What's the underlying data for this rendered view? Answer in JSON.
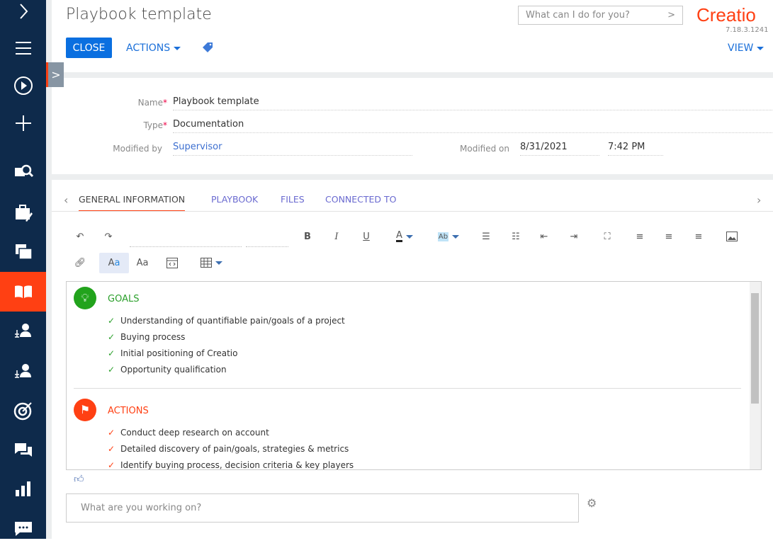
{
  "page": {
    "title": "Playbook template"
  },
  "toolbar": {
    "close_label": "CLOSE",
    "actions_label": "ACTIONS",
    "view_label": "VIEW"
  },
  "search": {
    "placeholder": "What can I do for you?"
  },
  "brand": {
    "logo": "Creatio",
    "version": "7.18.3.1241",
    "accent": "#ff4013",
    "primary": "#0a6fe0"
  },
  "sidebar": {
    "items": [
      {
        "icon": "chevron-right-icon"
      },
      {
        "icon": "menu-icon"
      },
      {
        "icon": "play-icon"
      },
      {
        "icon": "plus-icon"
      },
      {
        "icon": "search-feed-icon"
      },
      {
        "icon": "briefcase-icon"
      },
      {
        "icon": "folders-icon"
      },
      {
        "icon": "book-icon",
        "active": true
      },
      {
        "icon": "contacts-icon"
      },
      {
        "icon": "contacts-alt-icon"
      },
      {
        "icon": "target-icon"
      },
      {
        "icon": "chat-icon"
      },
      {
        "icon": "chart-icon"
      },
      {
        "icon": "message-icon"
      }
    ]
  },
  "fields": {
    "name": {
      "label": "Name",
      "value": "Playbook template"
    },
    "type": {
      "label": "Type",
      "value": "Documentation"
    },
    "modified_by": {
      "label": "Modified by",
      "value": "Supervisor"
    },
    "modified_on": {
      "label": "Modified on",
      "date": "8/31/2021",
      "time": "7:42 PM"
    }
  },
  "tabs": [
    {
      "label": "GENERAL INFORMATION",
      "active": true
    },
    {
      "label": "PLAYBOOK"
    },
    {
      "label": "FILES"
    },
    {
      "label": "CONNECTED TO"
    }
  ],
  "editor": {
    "sections": [
      {
        "title": "GOALS",
        "color": "#2ca02c",
        "items": [
          "Understanding of quantifiable pain/goals of a project",
          "Buying process",
          "Initial positioning of Creatio",
          "Opportunity qualification"
        ]
      },
      {
        "title": "ACTIONS",
        "color": "#ff4013",
        "items": [
          "Conduct deep research on account",
          "Detailed discovery of pain/goals, strategies & metrics",
          "Identify buying process, decision criteria & key players"
        ]
      }
    ]
  },
  "feed": {
    "placeholder": "What are you working on?"
  }
}
